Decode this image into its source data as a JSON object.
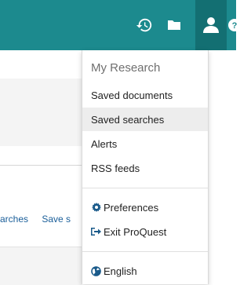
{
  "header": {
    "bg_color": "#1c8a8e",
    "active_icon_bg": "#136f72",
    "icons": [
      "history-icon",
      "folder-icon",
      "user-icon",
      "help-icon"
    ]
  },
  "background_links": {
    "searches": "arches",
    "save": "Save s"
  },
  "menu": {
    "heading": "My Research",
    "items": [
      {
        "label": "Saved documents"
      },
      {
        "label": "Saved searches"
      },
      {
        "label": "Alerts"
      },
      {
        "label": "RSS feeds"
      }
    ],
    "preferences": "Preferences",
    "exit": "Exit ProQuest",
    "language": "English"
  }
}
